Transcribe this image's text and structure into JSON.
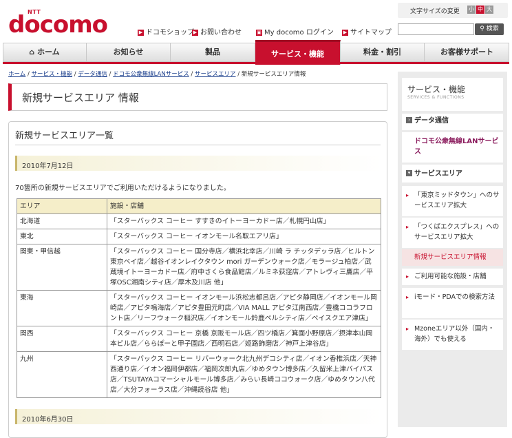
{
  "header": {
    "logo_ntt": "NTT",
    "logo_docomo": "docomo",
    "font_size_label": "文字サイズの変更",
    "font_sizes": [
      "小",
      "中",
      "大"
    ],
    "util_links": [
      "ドコモショップ",
      "お問い合わせ",
      "My docomo ログイン",
      "サイトマップ"
    ],
    "search_placeholder": "",
    "search_button": "検索"
  },
  "gnav": [
    "ホーム",
    "お知らせ",
    "製品",
    "サービス・機能",
    "料金・割引",
    "お客様サポート"
  ],
  "breadcrumb": [
    "ホーム",
    "サービス・機能",
    "データ通信",
    "ドコモ公衆無線LANサービス",
    "サービスエリア",
    "新規サービスエリア情報"
  ],
  "page_title": "新規サービスエリア 情報",
  "section_title": "新規サービスエリア一覧",
  "date1": "2010年7月12日",
  "intro": "70箇所の新規サービスエリアでご利用いただけるようになりました。",
  "table": {
    "headers": [
      "エリア",
      "施設・店舗"
    ],
    "rows": [
      [
        "北海道",
        "「スターバックス コーヒー すすきのイトーヨーカドー店／札幌円山店」"
      ],
      [
        "東北",
        "「スターバックス コーヒー イオンモール名取エアリ店」"
      ],
      [
        "関東・甲信越",
        "「スターバックス コーヒー 国分寺店／横浜北幸店／川崎 ラ チッタデッラ店／ヒルトン東京ベイ店／越谷イオンレイクタウン mori ガーデンウォーク店／モラージュ柏店／武蔵境イトーヨーカドー店／府中さくら食品館店／ルミネ荻窪店／アトレヴィ三鷹店／平塚OSC湘南シティ店／厚木及川店 他」"
      ],
      [
        "東海",
        "「スターバックス コーヒー イオンモール浜松志都呂店／アピタ静岡店／イオンモール岡崎店／アピタ鳴海店／アピタ豊田元町店／VIA MALL アピタ江南西店／豊橋ココラフロント店／リーフウォーク稲沢店／イオンモール鈴鹿ベルシティ店／ベイスクエア津店」"
      ],
      [
        "関西",
        "「スターバックス コーヒー 京橋 京阪モール店／四ツ橋店／箕面小野原店／摂津本山岡本ビル店／ららぽーと甲子園店／西明石店／姫路飾磨店／神戸上津谷店」"
      ],
      [
        "九州",
        "「スターバックス コーヒー リバーウォーク北九州デコシティ店／イオン香椎浜店／天神西通り店／イオン福岡伊都店／福岡次郎丸店／ゆめタウン博多店／久留米上津バイパス店／TSUTAYAコマーシャルモール博多店／みらい長崎ココウォーク店／ゆめタウン八代店／大分フォーラス店／沖縄読谷店 他」"
      ]
    ]
  },
  "date2": "2010年6月30日",
  "sidebar": {
    "title": "サービス・機能",
    "subtitle": "SERVICES & FUNCTIONS",
    "data_comm": "データ通信",
    "wlan": "ドコモ公衆無線LANサービス",
    "area": "サービスエリア",
    "sub_items": [
      "「東京ミッドタウン」へのサービスエリア拡大",
      "「つくばエクスプレス」へのサービスエリア拡大",
      "新規サービスエリア情報",
      "ご利用可能な施設・店舗",
      "iモード・PDAでの検索方法",
      "Mzoneエリア以外（国内・海外）でも使える"
    ]
  }
}
